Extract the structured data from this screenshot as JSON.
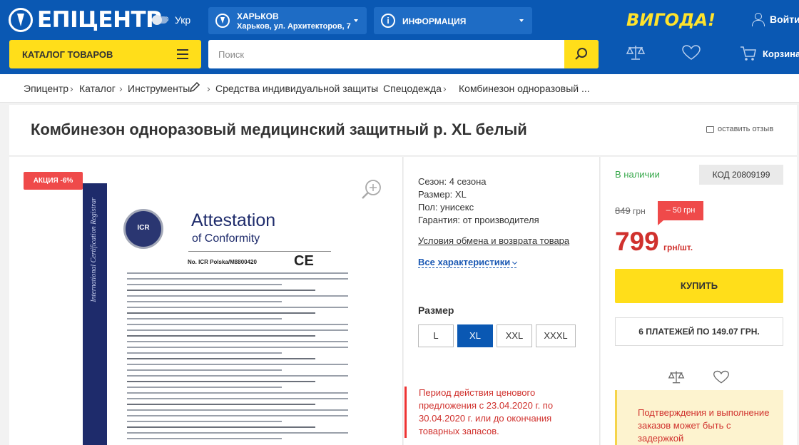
{
  "header": {
    "logo": "ЕПІЦЕНТР",
    "logo_mark": "®",
    "lang": "Укр",
    "city_name": "ХАРЬКОВ",
    "city_address": "Харьков, ул. Архитекторов, 7",
    "info_label": "ИНФОРМАЦИЯ",
    "promo": "ВИГОДА!",
    "login": "Войти",
    "catalog_label": "КАТАЛОГ ТОВАРОВ",
    "search_placeholder": "Поиск",
    "cart_label": "Корзина"
  },
  "breadcrumb": [
    "Эпицентр",
    "Каталог",
    "Инструменты",
    "Средства индивидуальной защиты",
    "Спецодежда",
    "Комбинезон одноразовый ..."
  ],
  "product": {
    "title": "Комбинезон одноразовый медицинский защитный р. XL белый",
    "review_label": "оставить отзыв",
    "sale_badge": "АКЦИЯ -6%",
    "specs": [
      "Сезон: 4 сезона",
      "Размер: XL",
      "Пол: унисекс",
      "Гарантия: от производителя"
    ],
    "exchange_link": "Условия обмена и возврата товара",
    "all_specs": "Все характеристики",
    "size_label": "Размер",
    "sizes": [
      "L",
      "XL",
      "XXL",
      "XXXL"
    ],
    "selected_size": "XL",
    "period": "Период действия ценового предложения с 23.04.2020 г. по 30.04.2020 г. или до окончания товарных запасов."
  },
  "buy_box": {
    "stock": "В наличии",
    "code": "КОД 20809199",
    "old_price": "849",
    "old_currency": "грн",
    "discount": "– 50 грн",
    "price": "799",
    "price_unit": "грн/шт.",
    "buy_label": "КУПИТЬ",
    "installments": "6 ПЛАТЕЖЕЙ ПО 149.07 ГРН.",
    "notice": "Подтверждения и выполнение заказов может быть с задержкой"
  },
  "certificate": {
    "spine": "International Certification Registrar",
    "seal": "ICR",
    "title": "Attestation",
    "subtitle": "of Conformity",
    "number": "No. ICR Polska/M8800420",
    "mark": "CE"
  },
  "colors": {
    "header_blue": "#0a58b3",
    "accent_yellow": "#ffde1a",
    "price_red": "#d0312d",
    "stock_green": "#37a84b"
  }
}
